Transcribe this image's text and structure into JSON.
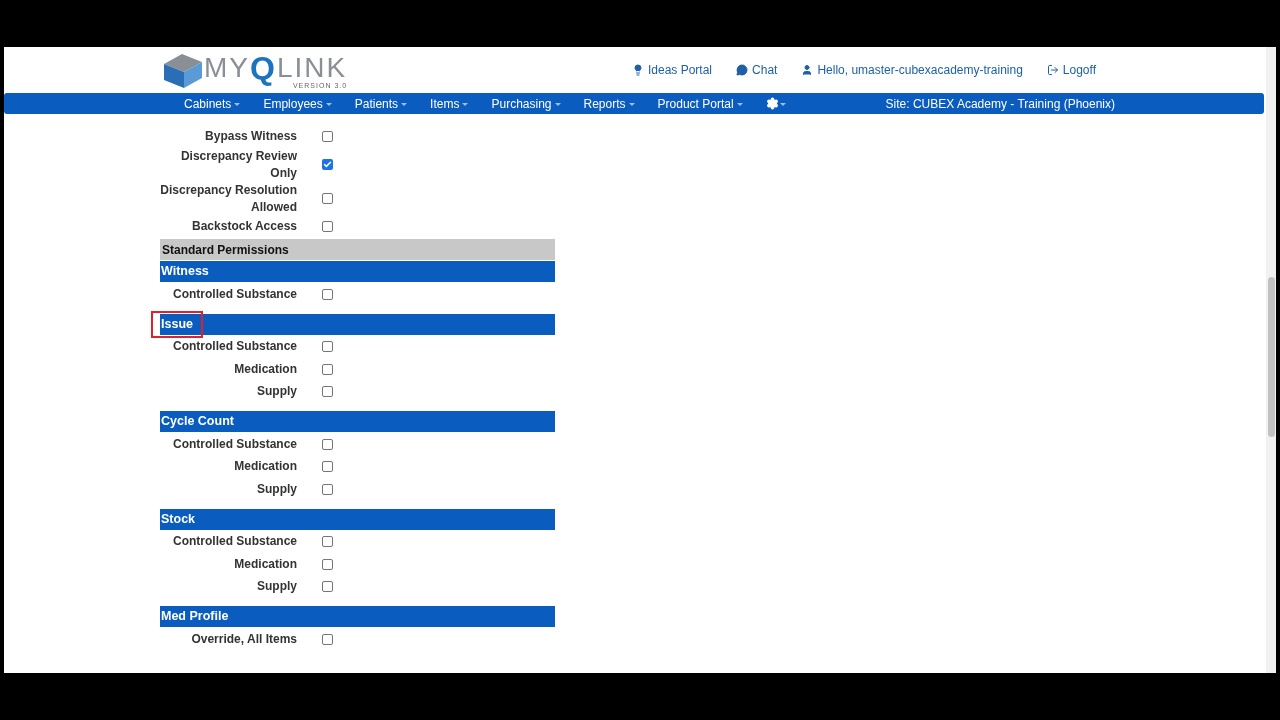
{
  "logo": {
    "left": "MY",
    "mark": "Q",
    "right": "LINK",
    "version": "VERSION 3.0"
  },
  "top_links": [
    {
      "kind": "bulb",
      "label": "Ideas Portal"
    },
    {
      "kind": "chat",
      "label": "Chat"
    },
    {
      "kind": "user",
      "label": "Hello, umaster-cubexacademy-training"
    },
    {
      "kind": "logoff",
      "label": "Logoff"
    }
  ],
  "nav": {
    "items": [
      "Cabinets",
      "Employees",
      "Patients",
      "Items",
      "Purchasing",
      "Reports",
      "Product Portal"
    ],
    "site": "Site: CUBEX Academy - Training (Phoenix)"
  },
  "permissions": [
    {
      "label": "Bypass Witness",
      "checked": false
    },
    {
      "label": "Discrepancy Review Only",
      "checked": true
    },
    {
      "label": "Discrepancy Resolution Allowed",
      "checked": false
    },
    {
      "label": "Backstock Access",
      "checked": false
    }
  ],
  "standard_title": "Standard Permissions",
  "sections": [
    {
      "title": "Witness",
      "highlighted": false,
      "rows": [
        {
          "label": "Controlled Substance",
          "checked": false
        }
      ]
    },
    {
      "title": "Issue",
      "highlighted": true,
      "rows": [
        {
          "label": "Controlled Substance",
          "checked": false
        },
        {
          "label": "Medication",
          "checked": false
        },
        {
          "label": "Supply",
          "checked": false
        }
      ]
    },
    {
      "title": "Cycle Count",
      "highlighted": false,
      "rows": [
        {
          "label": "Controlled Substance",
          "checked": false
        },
        {
          "label": "Medication",
          "checked": false
        },
        {
          "label": "Supply",
          "checked": false
        }
      ]
    },
    {
      "title": "Stock",
      "highlighted": false,
      "rows": [
        {
          "label": "Controlled Substance",
          "checked": false
        },
        {
          "label": "Medication",
          "checked": false
        },
        {
          "label": "Supply",
          "checked": false
        }
      ]
    },
    {
      "title": "Med Profile",
      "highlighted": false,
      "rows": [
        {
          "label": "Override, All Items",
          "checked": false
        }
      ]
    }
  ]
}
